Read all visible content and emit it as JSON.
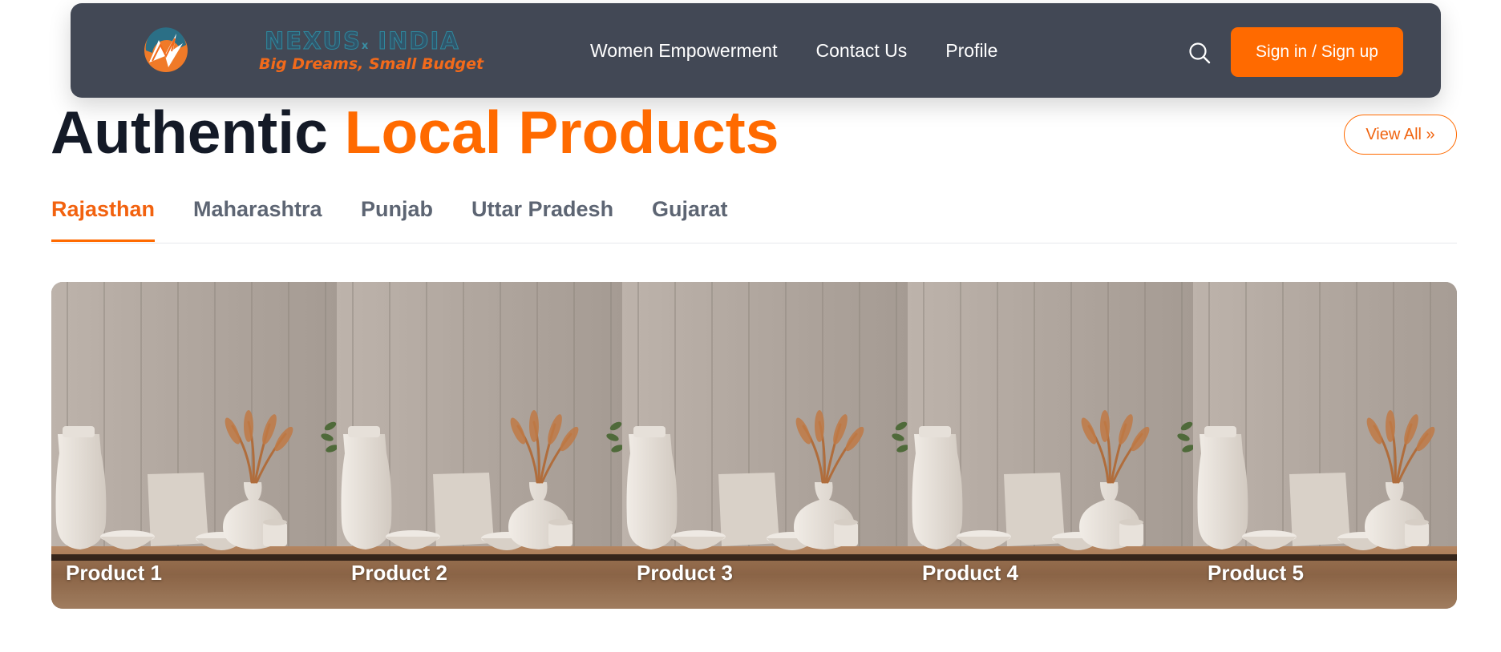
{
  "navbar": {
    "brand_name": "NEXUS",
    "brand_x": "x",
    "brand_country": "INDIA",
    "brand_tagline": "Big Dreams, Small Budget",
    "links": [
      {
        "label": "Women Empowerment"
      },
      {
        "label": "Contact Us"
      },
      {
        "label": "Profile"
      }
    ],
    "search_icon": "search-icon",
    "signin_label": "Sign in / Sign up"
  },
  "section": {
    "title_part1": "Authentic",
    "title_part2": "Local Products",
    "view_all_label": "View All »"
  },
  "tabs": [
    {
      "label": "Rajasthan",
      "active": true
    },
    {
      "label": "Maharashtra",
      "active": false
    },
    {
      "label": "Punjab",
      "active": false
    },
    {
      "label": "Uttar Pradesh",
      "active": false
    },
    {
      "label": "Gujarat",
      "active": false
    }
  ],
  "products": [
    {
      "name": "Product 1"
    },
    {
      "name": "Product 2"
    },
    {
      "name": "Product 3"
    },
    {
      "name": "Product 4"
    },
    {
      "name": "Product 5"
    }
  ],
  "colors": {
    "accent": "#ff6a00",
    "navbar_bg": "#424855",
    "heading_dark": "#141a27",
    "tab_inactive": "#5d6573"
  }
}
